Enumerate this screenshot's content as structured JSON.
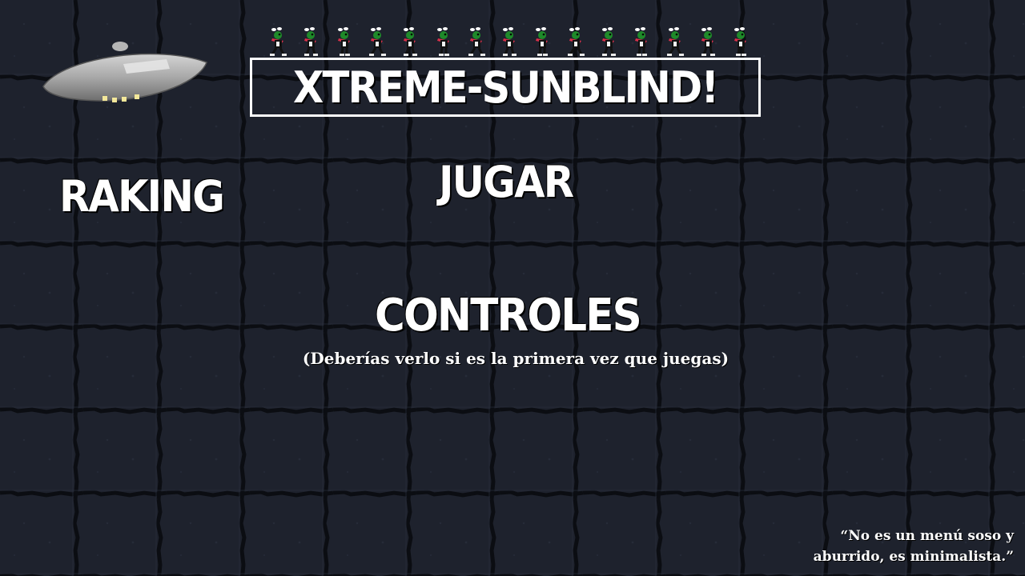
{
  "game": {
    "title": "XTREME-SUNBLIND!"
  },
  "menu": {
    "ranking_label": "RAKING",
    "play_label": "JUGAR",
    "controls_label": "CONTROLES",
    "controls_hint": "(Deberías verlo si es la primera vez que juegas)"
  },
  "quote": {
    "line1": "“No es un menú soso y",
    "line2": "aburrido, es minimalista.”"
  },
  "sprites": {
    "ufo_icon": "flying-saucer-icon",
    "runner_icon": "alien-runner-icon",
    "runner_count": 15
  },
  "colors": {
    "background": "#1e222d",
    "brick_line": "#0b0d12",
    "text": "#ffffff",
    "runner_body": "#1f8a2a",
    "runner_scarf": "#d8304a"
  }
}
